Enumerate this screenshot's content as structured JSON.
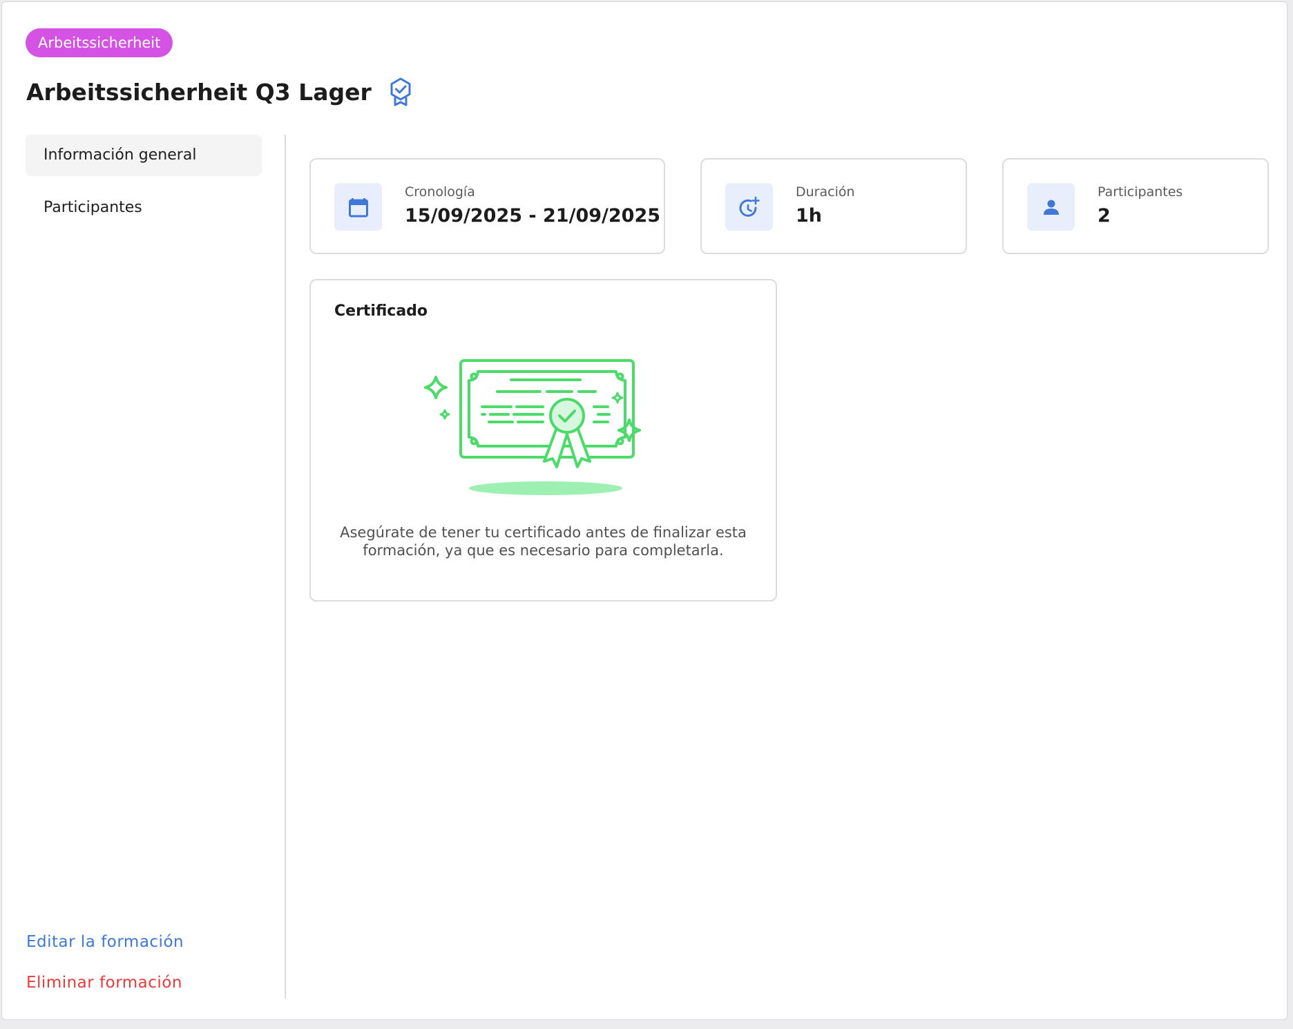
{
  "header": {
    "category_tag": "Arbeitssicherheit",
    "title": "Arbeitssicherheit Q3 Lager",
    "badge_icon": "certified-badge-icon"
  },
  "sidebar": {
    "items": [
      {
        "label": "Información general",
        "active": true
      },
      {
        "label": "Participantes",
        "active": false
      }
    ],
    "edit_link": "Editar la formación",
    "delete_link": "Eliminar formación"
  },
  "stats": {
    "timeline": {
      "label": "Cronología",
      "value": "15/09/2025 - 21/09/2025",
      "icon": "calendar-icon"
    },
    "duration": {
      "label": "Duración",
      "value": "1h",
      "icon": "clock-plus-icon"
    },
    "participants": {
      "label": "Participantes",
      "value": "2",
      "icon": "person-icon"
    }
  },
  "certificate": {
    "title": "Certificado",
    "illustration": "certificate-illustration",
    "description": "Asegúrate de tener tu certificado antes de finalizar esta formación, ya que es necesario para completarla."
  },
  "colors": {
    "tag": "#d553e4",
    "accent_blue": "#3f78d6",
    "danger_red": "#ea3a3a",
    "icon_bg": "#e8eefb",
    "certificate_green": "#4cdb6a"
  }
}
